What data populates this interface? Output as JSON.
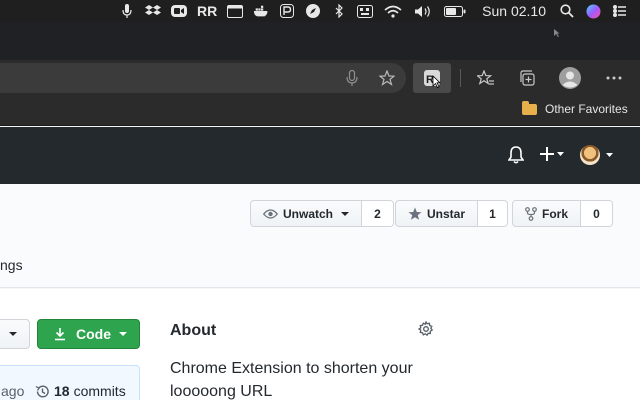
{
  "menubar": {
    "icons": [
      "microphone-icon",
      "dropbox-icon",
      "zoom-icon",
      "rr-icon",
      "window-icon",
      "docker-icon",
      "p-icon",
      "compass-icon",
      "bluetooth-icon",
      "keyboard-icon",
      "wifi-icon",
      "volume-icon",
      "battery-icon",
      "search-icon",
      "siri-icon",
      "control-center-icon"
    ],
    "rr_label": "RR",
    "clock": "Sun 02.10"
  },
  "toolbar": {
    "icons": [
      "microphone-icon",
      "star-icon",
      "extension-icon",
      "favorites-icon",
      "collections-icon",
      "profile-icon",
      "more-icon"
    ]
  },
  "favorites_bar": {
    "other_favorites": "Other Favorites"
  },
  "github_header": {
    "icons": [
      "bell-icon",
      "plus-icon",
      "avatar"
    ]
  },
  "repo_actions": {
    "watch_label": "Unwatch",
    "watch_count": "2",
    "star_label": "Unstar",
    "star_count": "1",
    "fork_label": "Fork",
    "fork_count": "0"
  },
  "repo_nav": {
    "settings_tab_partial": "ngs"
  },
  "main": {
    "code_button": "Code",
    "commit_ago": "ago",
    "commit_count": "18",
    "commit_label": "commits"
  },
  "about": {
    "title": "About",
    "description": "Chrome Extension to shorten your looooong URL"
  }
}
